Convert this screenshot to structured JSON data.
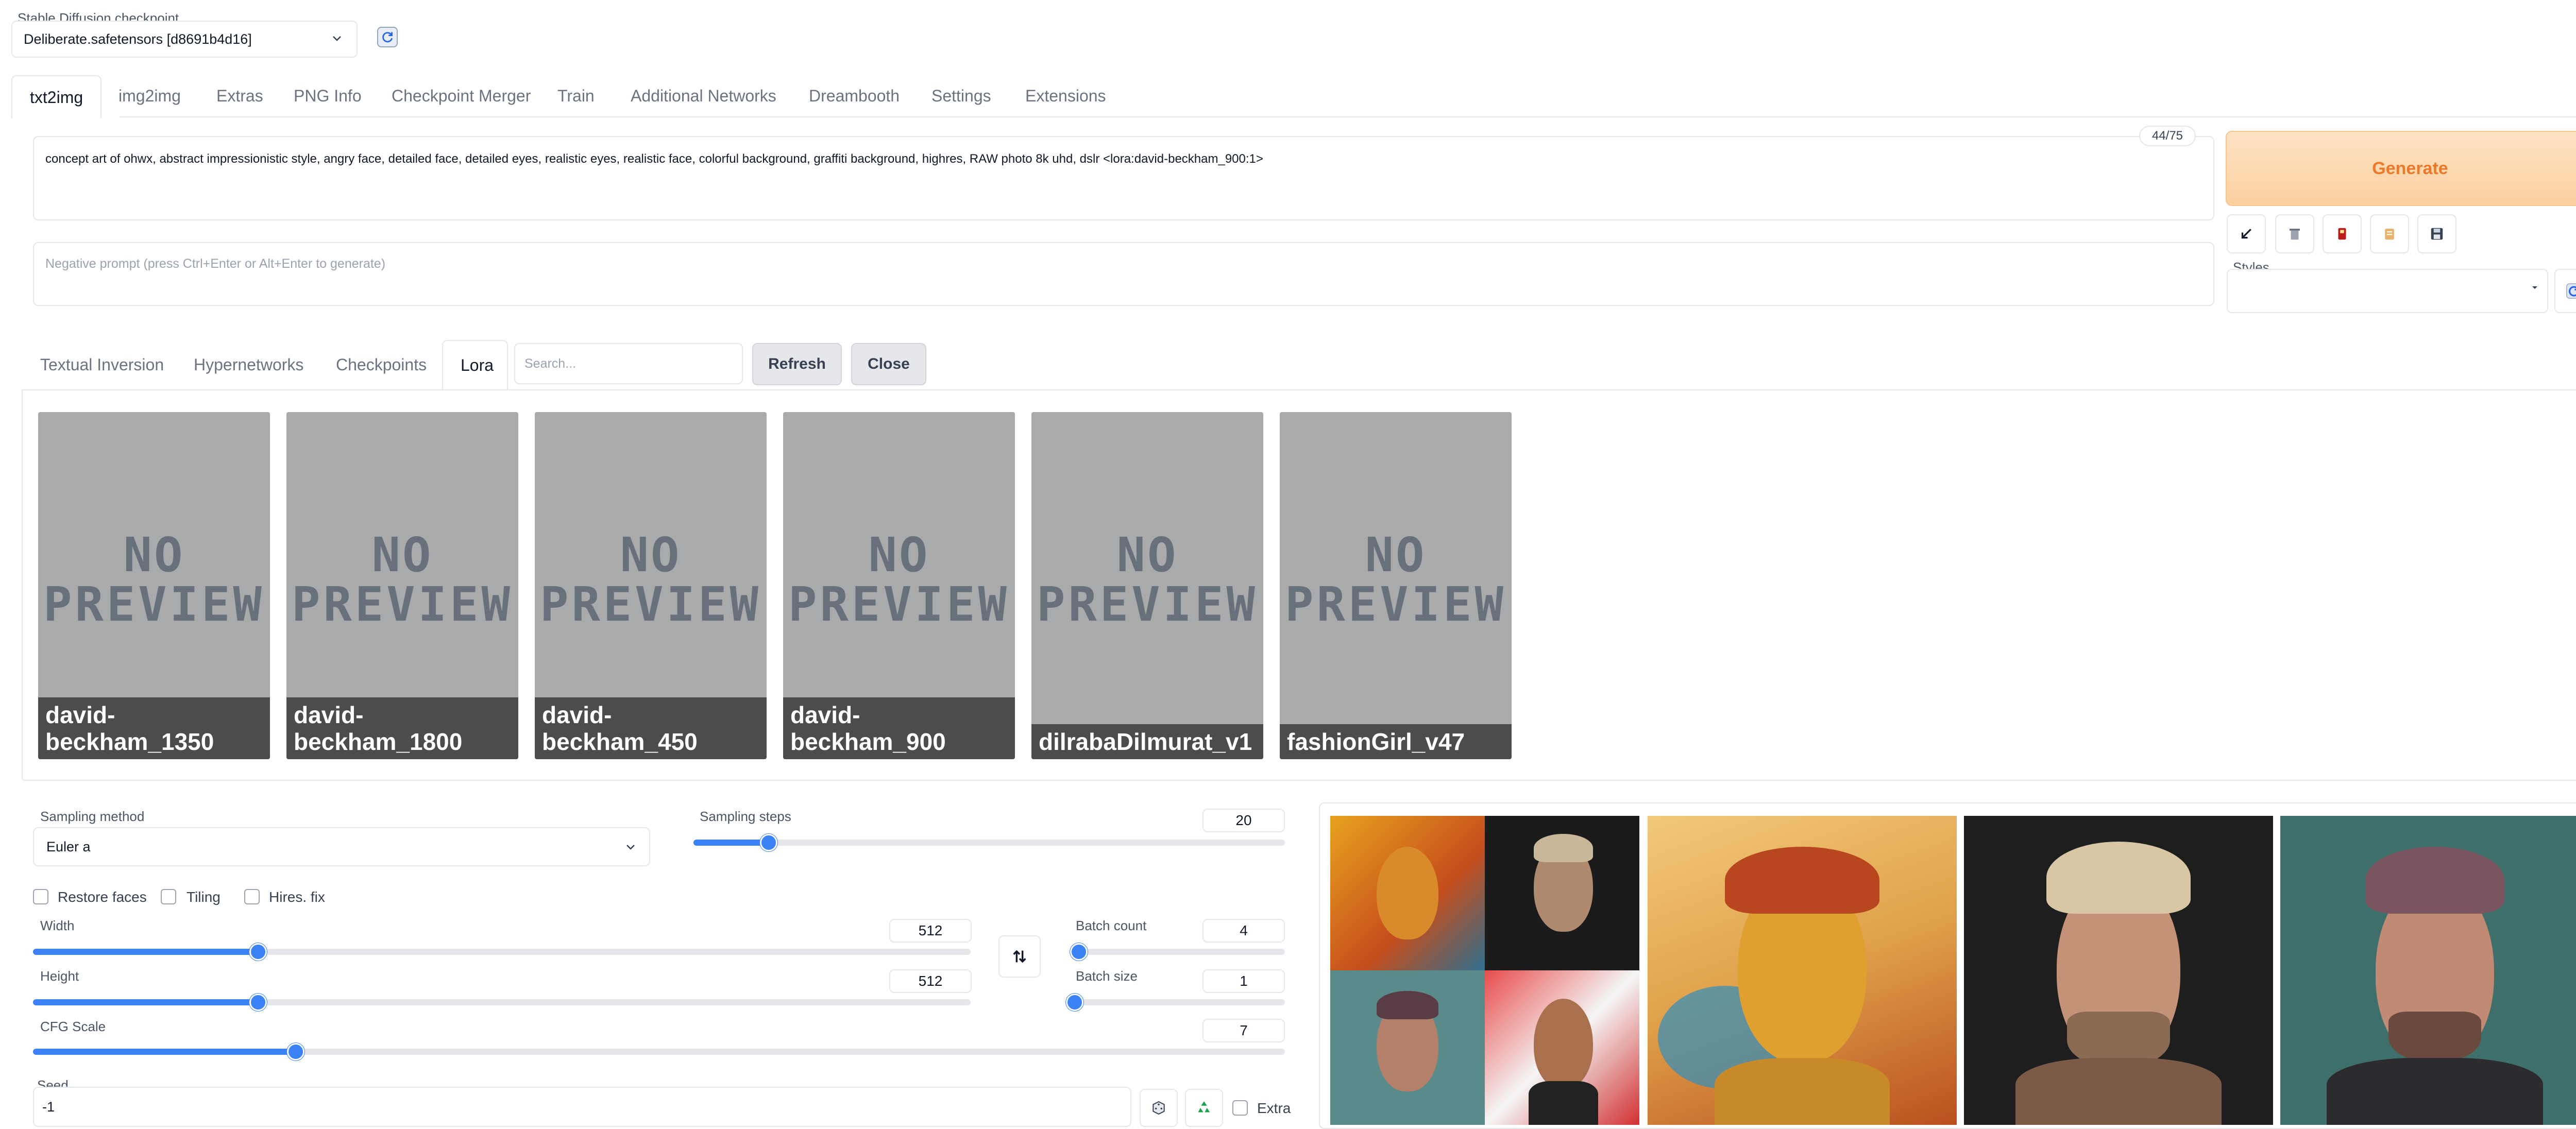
{
  "checkpoint": {
    "label": "Stable Diffusion checkpoint",
    "value": "Deliberate.safetensors [d8691b4d16]"
  },
  "tabs": [
    "txt2img",
    "img2img",
    "Extras",
    "PNG Info",
    "Checkpoint Merger",
    "Train",
    "Additional Networks",
    "Dreambooth",
    "Settings",
    "Extensions"
  ],
  "prompt": {
    "text": "concept art of ohwx, abstract impressionistic style, angry face, detailed face, detailed eyes, realistic eyes, realistic face, colorful background, graffiti background, highres, RAW photo 8k uhd, dslr <lora:david-beckham_900:1>",
    "token_count": "44/75"
  },
  "negative_prompt": {
    "placeholder": "Negative prompt (press Ctrl+Enter or Alt+Enter to generate)"
  },
  "generate_label": "Generate",
  "styles_label": "Styles",
  "network_tabs": [
    "Textual Inversion",
    "Hypernetworks",
    "Checkpoints",
    "Lora"
  ],
  "network_search_placeholder": "Search...",
  "refresh_label": "Refresh",
  "close_label": "Close",
  "no_preview": {
    "line1": "NO",
    "line2": "PREVIEW"
  },
  "lora_cards": [
    {
      "name": "david-beckham_1350"
    },
    {
      "name": "david-beckham_1800"
    },
    {
      "name": "david-beckham_450"
    },
    {
      "name": "david-beckham_900"
    },
    {
      "name": "dilrabaDilmurat_v1"
    },
    {
      "name": "fashionGirl_v47"
    }
  ],
  "sampling": {
    "method_label": "Sampling method",
    "method_value": "Euler a",
    "steps_label": "Sampling steps",
    "steps_value": "20",
    "steps_min": 1,
    "steps_max": 150
  },
  "checkboxes": {
    "restore_faces": "Restore faces",
    "tiling": "Tiling",
    "hires": "Hires. fix"
  },
  "width": {
    "label": "Width",
    "value": "512",
    "fraction": 0.24
  },
  "height": {
    "label": "Height",
    "value": "512",
    "fraction": 0.24
  },
  "batch_count": {
    "label": "Batch count",
    "value": "4",
    "fraction": 0.02
  },
  "batch_size": {
    "label": "Batch size",
    "value": "1",
    "fraction": 0.0
  },
  "cfg": {
    "label": "CFG Scale",
    "value": "7",
    "fraction": 0.21
  },
  "seed": {
    "label": "Seed",
    "value": "-1",
    "extra_label": "Extra"
  },
  "colors": {
    "accent": "#3b82f6",
    "generate_bg": "#fcd9b4",
    "generate_text": "#ea7a2a"
  }
}
